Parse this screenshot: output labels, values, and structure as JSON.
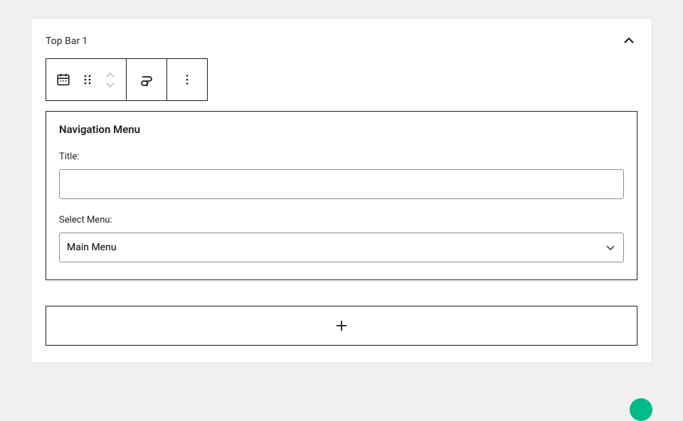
{
  "panel": {
    "title": "Top Bar 1"
  },
  "block": {
    "heading": "Navigation Menu",
    "title_field": {
      "label": "Title:",
      "value": ""
    },
    "select_menu": {
      "label": "Select Menu:",
      "selected": "Main Menu"
    }
  }
}
